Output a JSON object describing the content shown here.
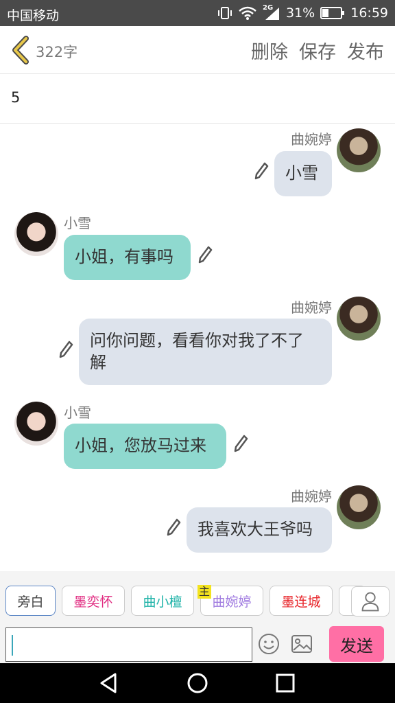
{
  "status_bar": {
    "carrier": "中国移动",
    "network": "2G",
    "battery": "31%",
    "time": "16:59"
  },
  "header": {
    "word_count": "322字",
    "actions": [
      "删除",
      "保存",
      "发布"
    ]
  },
  "title": {
    "value": "5"
  },
  "messages": [
    {
      "sender": "曲婉婷",
      "side": "right",
      "text": "小雪"
    },
    {
      "sender": "小雪",
      "side": "left",
      "text": "小姐，有事吗"
    },
    {
      "sender": "曲婉婷",
      "side": "right",
      "text_lines": [
        "问你问题，看看你对我了不了",
        "解"
      ]
    },
    {
      "sender": "小雪",
      "side": "left",
      "text": "小姐，您放马过来"
    },
    {
      "sender": "曲婉婷",
      "side": "right",
      "text": "我喜欢大王爷吗"
    }
  ],
  "characters": [
    {
      "label": "旁白",
      "color": "#444444"
    },
    {
      "label": "墨奕怀",
      "color": "#e0287f"
    },
    {
      "label": "曲小檀",
      "color": "#1fb3a8"
    },
    {
      "label": "曲婉婷",
      "color": "#a07be0"
    },
    {
      "label": "墨连城",
      "color": "#e8262b"
    }
  ],
  "main_character_badge": "主",
  "composer": {
    "value": "",
    "send_label": "发送"
  },
  "icons": {
    "back": "back-chevron-icon",
    "edit": "pencil-icon",
    "emoji": "smiley-icon",
    "image": "image-icon",
    "profile": "person-icon"
  },
  "colors": {
    "right_bubble": "#dde3ec",
    "left_bubble": "#8fd9cf",
    "send_button": "#ff6fa5",
    "back_icon": "#e8c84a"
  }
}
